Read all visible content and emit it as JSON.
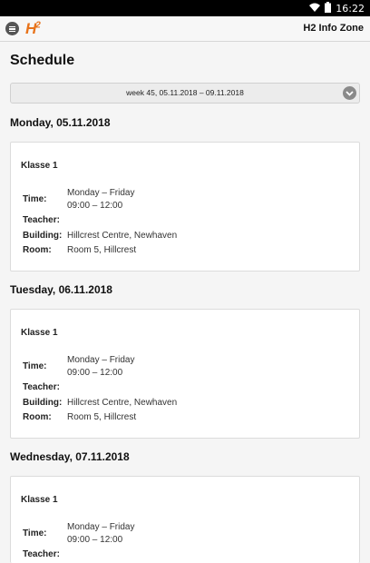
{
  "status": {
    "time": "16:22"
  },
  "appbar": {
    "logo_text": "H",
    "logo_sup": "2",
    "title": "H2 Info Zone"
  },
  "page": {
    "title": "Schedule"
  },
  "week_select": {
    "value": "week 45, 05.11.2018 – 09.11.2018"
  },
  "labels": {
    "time": "Time:",
    "teacher": "Teacher:",
    "building": "Building:",
    "room": "Room:"
  },
  "days": [
    {
      "heading": "Monday, 05.11.2018",
      "class": "Klasse 1",
      "time_days": "Monday – Friday",
      "time_hours": "09:00 – 12:00",
      "teacher": "",
      "building": "Hillcrest Centre, Newhaven",
      "room": "Room 5, Hillcrest"
    },
    {
      "heading": "Tuesday, 06.11.2018",
      "class": "Klasse 1",
      "time_days": "Monday – Friday",
      "time_hours": "09:00 – 12:00",
      "teacher": "",
      "building": "Hillcrest Centre, Newhaven",
      "room": "Room 5, Hillcrest"
    },
    {
      "heading": "Wednesday, 07.11.2018",
      "class": "Klasse 1",
      "time_days": "Monday – Friday",
      "time_hours": "09:00 – 12:00",
      "teacher": ""
    }
  ]
}
